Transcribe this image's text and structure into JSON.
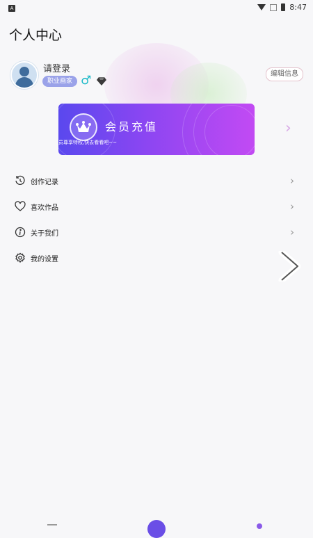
{
  "status_bar": {
    "left_icon": "A",
    "time": "8:47"
  },
  "page": {
    "title": "个人中心"
  },
  "profile": {
    "login_text": "请登录",
    "badge": "职业画家",
    "gender_symbol": "♂",
    "gender_color": "#18b8c7",
    "edit_label": "编辑信息"
  },
  "vip": {
    "title": "会员充值",
    "subtitle": "员尊享特权,快去看看吧~~",
    "gradient_start": "#5a48ee",
    "gradient_end": "#c24af3"
  },
  "menu": [
    {
      "label": "创作记录",
      "icon": "history-icon"
    },
    {
      "label": "喜欢作品",
      "icon": "heart-icon"
    },
    {
      "label": "关于我们",
      "icon": "info-icon"
    },
    {
      "label": "我的设置",
      "icon": "gear-icon"
    }
  ]
}
